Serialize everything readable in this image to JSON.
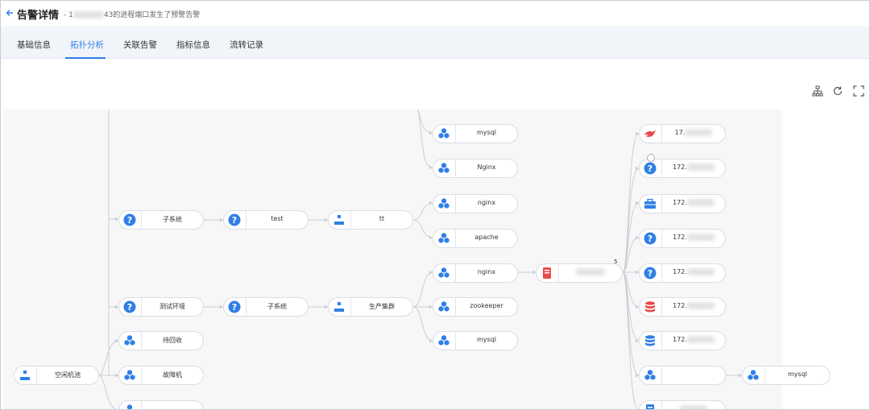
{
  "header": {
    "back_icon": "arrow-left-icon",
    "title": "告警详情",
    "subtitle": "43的进程端口发生了预警告警",
    "subtitle_prefix": "- 1"
  },
  "tabs": [
    {
      "label": "基础信息"
    },
    {
      "label": "拓扑分析"
    },
    {
      "label": "关联告警"
    },
    {
      "label": "指标信息"
    },
    {
      "label": "流转记录"
    }
  ],
  "active_tab": "拓扑分析",
  "toolbar": {
    "icons": [
      "tree-layout-icon",
      "refresh-icon",
      "fullscreen-icon"
    ]
  },
  "colors": {
    "accent": "#2f7fe6",
    "icon_blue": "#2f7fe6",
    "icon_red": "#e94b4b"
  },
  "topology": {
    "nodes": [
      {
        "id": "mysql1",
        "label": "mysql",
        "icon": "cluster-icon"
      },
      {
        "id": "nginx_top",
        "label": "Nginx",
        "icon": "cluster-icon"
      },
      {
        "id": "sub1",
        "label": "子系统",
        "icon": "question-icon"
      },
      {
        "id": "test",
        "label": "test",
        "icon": "question-icon"
      },
      {
        "id": "tt",
        "label": "tt",
        "icon": "group-icon"
      },
      {
        "id": "nginx2",
        "label": "nginx",
        "icon": "cluster-icon"
      },
      {
        "id": "apache",
        "label": "apache",
        "icon": "cluster-icon"
      },
      {
        "id": "nginx3",
        "label": "nginx",
        "icon": "cluster-icon"
      },
      {
        "id": "server",
        "label": "",
        "icon": "server-icon"
      },
      {
        "id": "env",
        "label": "测试环境",
        "icon": "question-icon"
      },
      {
        "id": "sub2",
        "label": "子系统",
        "icon": "question-icon"
      },
      {
        "id": "prod",
        "label": "生产集群",
        "icon": "group-icon"
      },
      {
        "id": "zk",
        "label": "zookeeper",
        "icon": "cluster-icon"
      },
      {
        "id": "mysql2",
        "label": "mysql",
        "icon": "cluster-icon"
      },
      {
        "id": "recycle",
        "label": "待回收",
        "icon": "cluster-icon"
      },
      {
        "id": "pool",
        "label": "空闲机池",
        "icon": "group-icon"
      },
      {
        "id": "fault",
        "label": "故障机",
        "icon": "cluster-icon"
      },
      {
        "id": "r1",
        "label": "17.",
        "icon": "bird-icon"
      },
      {
        "id": "r2",
        "label": "172.",
        "icon": "question-icon"
      },
      {
        "id": "r3",
        "label": "172.",
        "icon": "briefcase-icon"
      },
      {
        "id": "r4",
        "label": "172.",
        "icon": "question-icon"
      },
      {
        "id": "r5",
        "label": "172.",
        "icon": "question-icon"
      },
      {
        "id": "r6",
        "label": "172.",
        "icon": "database-red-icon"
      },
      {
        "id": "r7",
        "label": "172.",
        "icon": "database-blue-icon"
      },
      {
        "id": "r8",
        "label": "",
        "icon": "cluster-icon"
      },
      {
        "id": "mysql3",
        "label": "mysql",
        "icon": "cluster-icon"
      }
    ],
    "server_badge": "5"
  }
}
